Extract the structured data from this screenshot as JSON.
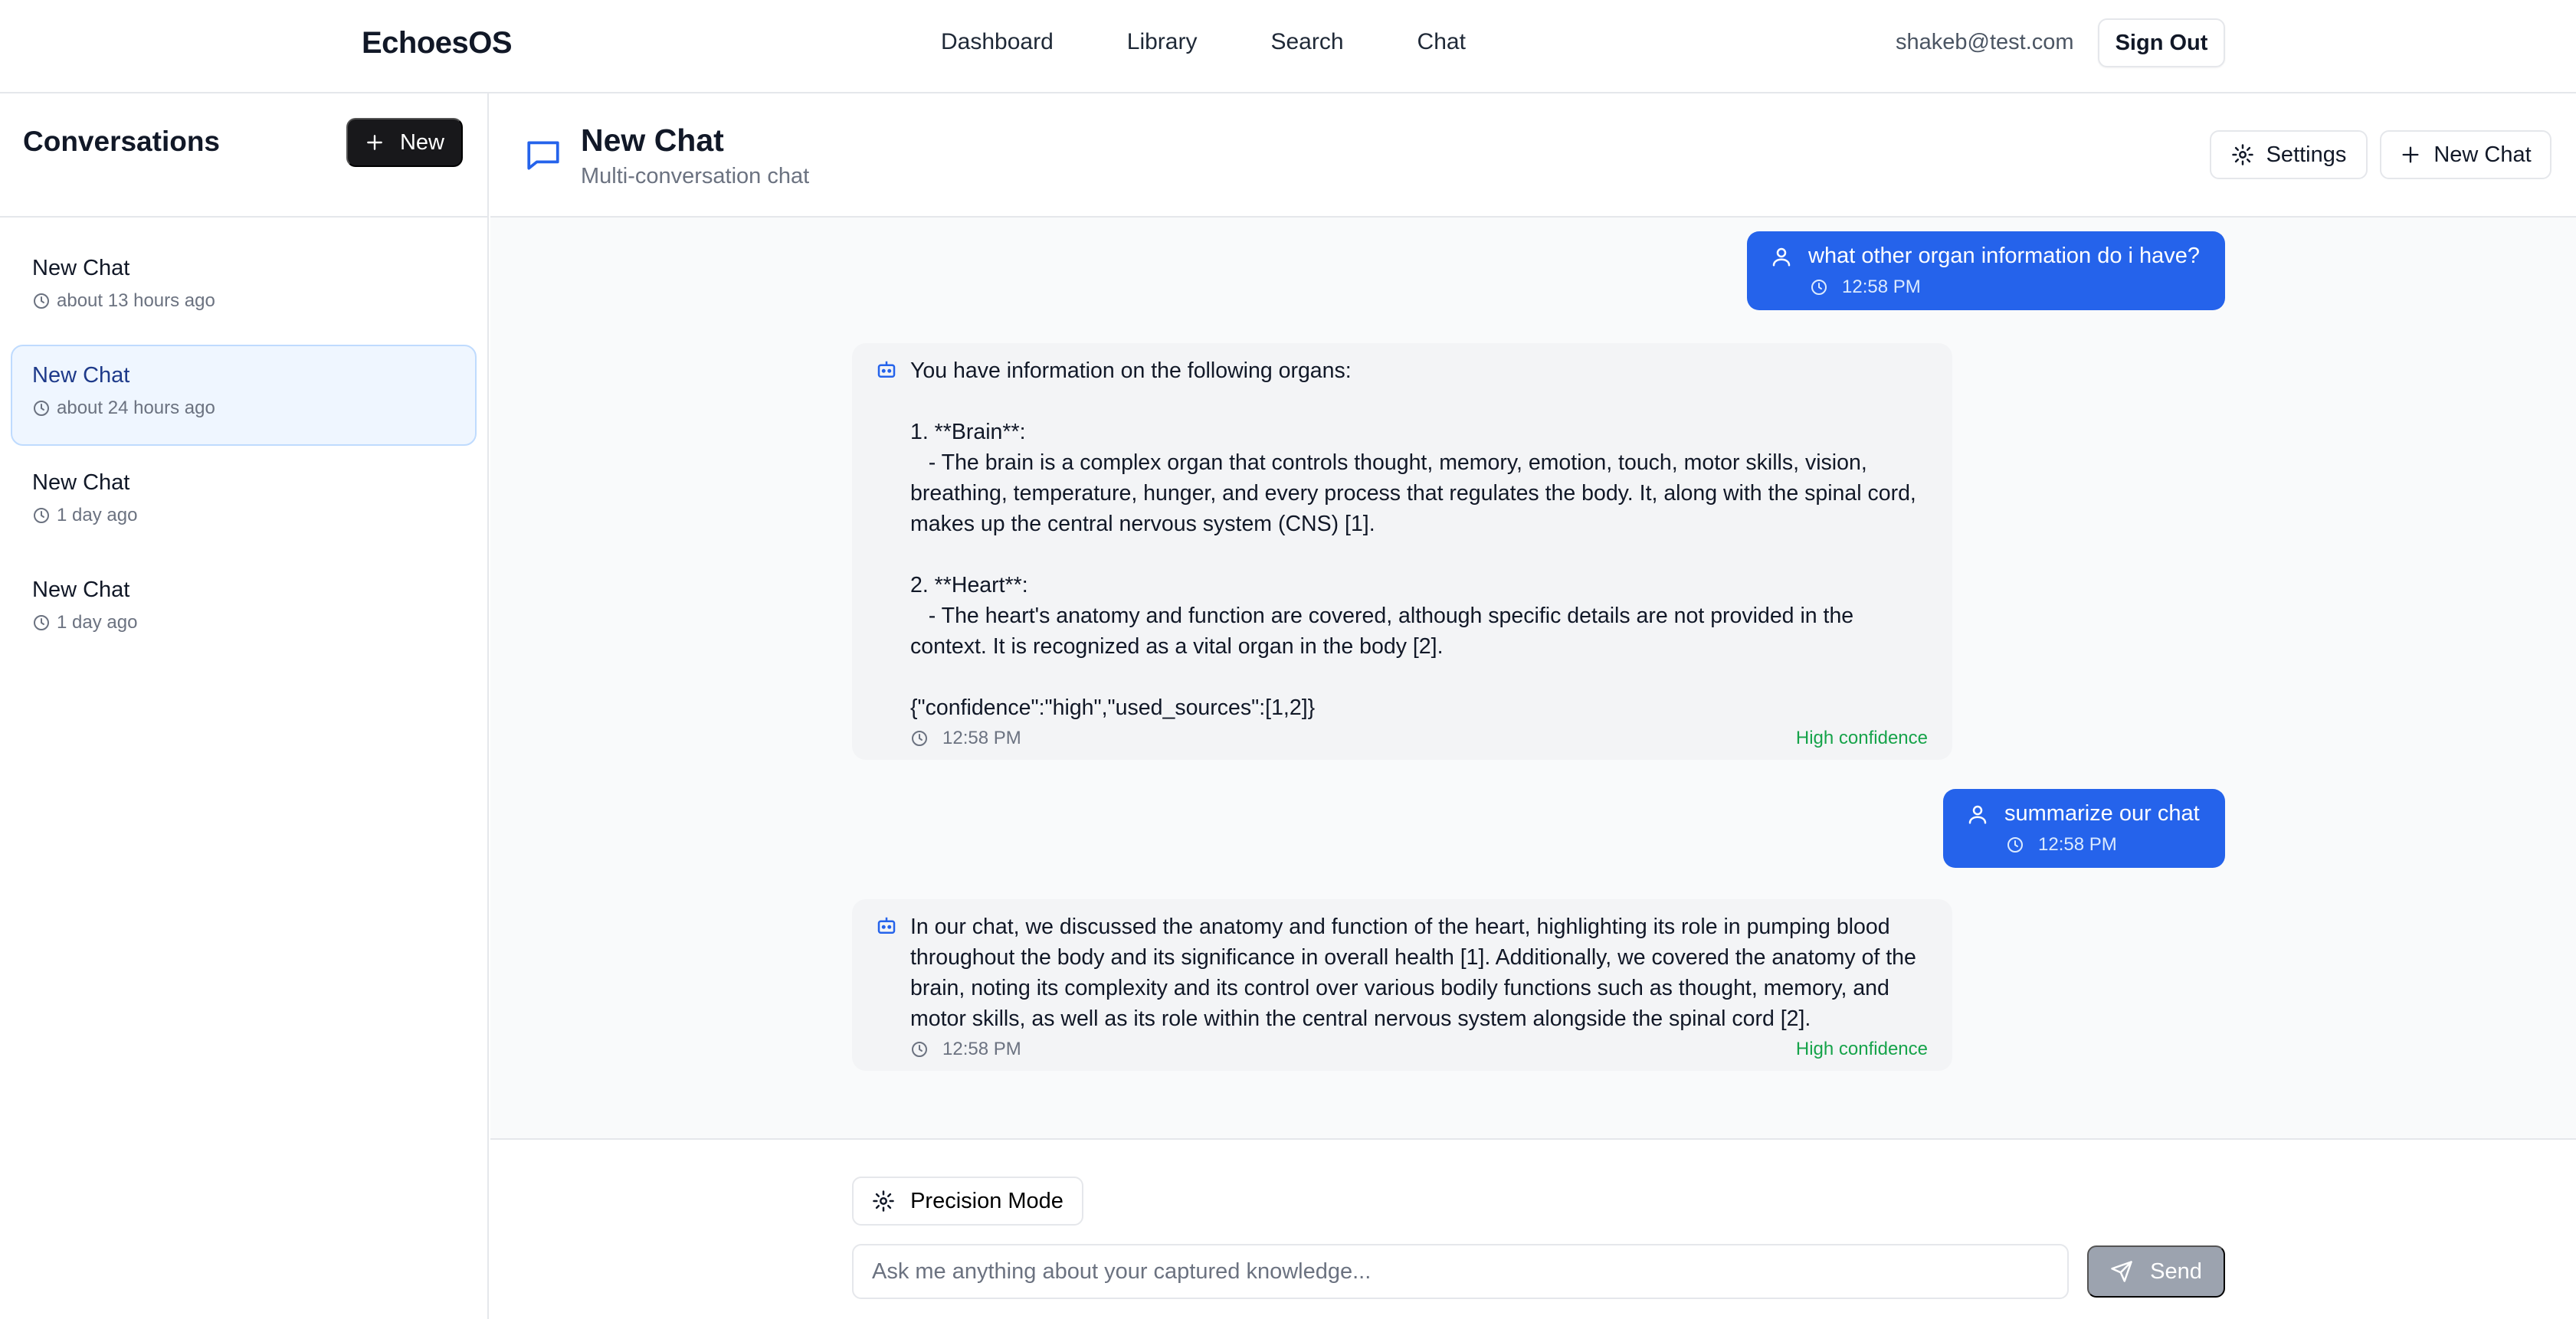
{
  "nav": {
    "brand": "EchoesOS",
    "links": [
      "Dashboard",
      "Library",
      "Search",
      "Chat"
    ],
    "user_email": "shakeb@test.com",
    "sign_out": "Sign Out"
  },
  "sidebar": {
    "title": "Conversations",
    "new_label": "New",
    "conversations": [
      {
        "title": "New Chat",
        "time": "about 13 hours ago",
        "active": false
      },
      {
        "title": "New Chat",
        "time": "about 24 hours ago",
        "active": true
      },
      {
        "title": "New Chat",
        "time": "1 day ago",
        "active": false
      },
      {
        "title": "New Chat",
        "time": "1 day ago",
        "active": false
      }
    ]
  },
  "chat": {
    "title": "New Chat",
    "subtitle": "Multi-conversation chat",
    "settings_label": "Settings",
    "new_chat_label": "New Chat",
    "messages": [
      {
        "role": "user",
        "text": "what other organ information do i have?",
        "time": "12:58 PM"
      },
      {
        "role": "assistant",
        "text": "You have information on the following organs:\n\n1. **Brain**:\n   - The brain is a complex organ that controls thought, memory, emotion, touch, motor skills, vision, breathing, temperature, hunger, and every process that regulates the body. It, along with the spinal cord, makes up the central nervous system (CNS) [1].\n\n2. **Heart**:\n   - The heart's anatomy and function are covered, although specific details are not provided in the context. It is recognized as a vital organ in the body [2].\n\n{\"confidence\":\"high\",\"used_sources\":[1,2]}",
        "time": "12:58 PM",
        "confidence": "High confidence"
      },
      {
        "role": "user",
        "text": "summarize our chat",
        "time": "12:58 PM"
      },
      {
        "role": "assistant",
        "text": "In our chat, we discussed the anatomy and function of the heart, highlighting its role in pumping blood throughout the body and its significance in overall health [1]. Additionally, we covered the anatomy of the brain, noting its complexity and its control over various bodily functions such as thought, memory, and motor skills, as well as its role within the central nervous system alongside the spinal cord [2].",
        "time": "12:58 PM",
        "confidence": "High confidence"
      }
    ]
  },
  "composer": {
    "precision_label": "Precision Mode",
    "placeholder": "Ask me anything about your captured knowledge...",
    "value": "",
    "send_label": "Send"
  },
  "colors": {
    "accent": "#2563eb",
    "confidence": "#16a34a",
    "send_disabled": "#9ca3af",
    "active_item_bg": "#eff6ff"
  }
}
